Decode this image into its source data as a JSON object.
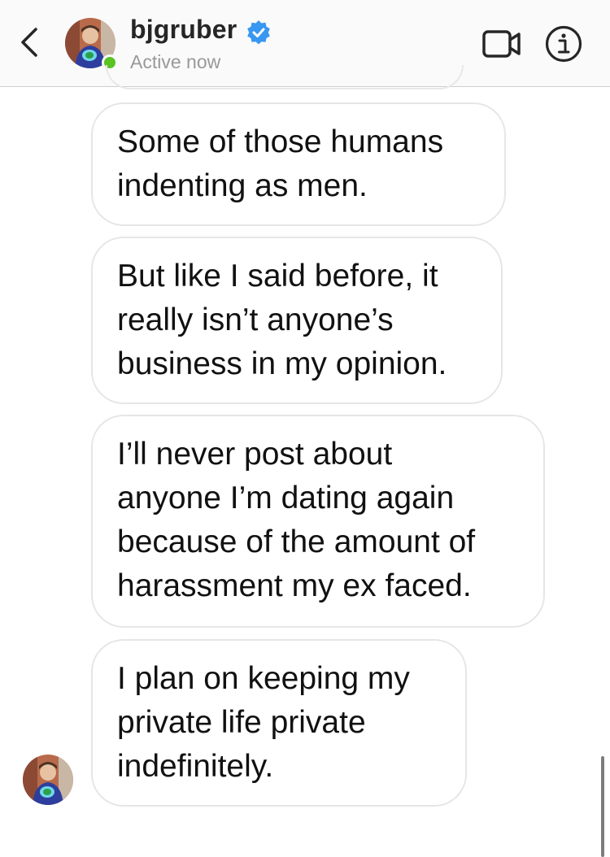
{
  "header": {
    "username": "bjgruber",
    "status": "Active now",
    "back_icon": "chevron-left-icon",
    "verified_icon": "verified-badge-icon",
    "video_icon": "video-camera-icon",
    "info_icon": "info-icon",
    "online_color": "#58c322",
    "verified_color": "#3897f0"
  },
  "messages": [
    {
      "text": "Some of those humans\nindenting as men."
    },
    {
      "text": "But like I said before, it\nreally isn’t anyone’s\nbusiness in my opinion."
    },
    {
      "text": "I’ll never post about\nanyone I’m dating again\nbecause of the amount of\nharassment my ex faced."
    },
    {
      "text": "I plan on keeping my\nprivate life private\nindefinitely."
    }
  ]
}
